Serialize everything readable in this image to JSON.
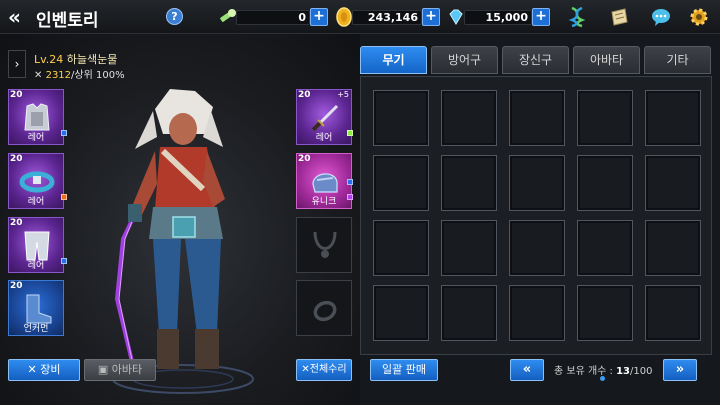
{
  "header": {
    "title": "인벤토리",
    "stamina": "0",
    "gold": "243,146",
    "gems": "15,000"
  },
  "character": {
    "level": "Lv.24",
    "name": "하늘색눈물",
    "power": "2312",
    "rank": "/상위 100%"
  },
  "left_slots": [
    {
      "level": "20",
      "grade": "레어"
    },
    {
      "level": "20",
      "grade": "레어"
    },
    {
      "level": "20",
      "grade": "레어"
    },
    {
      "level": "20",
      "grade": "언커먼"
    }
  ],
  "right_slots": [
    {
      "level": "20",
      "grade": "레어",
      "enhance": "+5"
    },
    {
      "level": "20",
      "grade": "유니크"
    }
  ],
  "buttons": {
    "equip": "장비",
    "avatar": "아바타",
    "repair_all": "전체수리",
    "bulk_sell": "일괄 판매"
  },
  "tabs": [
    {
      "label": "무기",
      "active": true
    },
    {
      "label": "방어구",
      "active": false
    },
    {
      "label": "장신구",
      "active": false
    },
    {
      "label": "아바타",
      "active": false
    },
    {
      "label": "기타",
      "active": false
    }
  ],
  "inventory": {
    "count_label": "총 보유 개수 :",
    "count": "13",
    "max": "/100"
  },
  "colors": {
    "accent_blue": "#1d6fd6",
    "rare": "#5b2590",
    "unique": "#a02a9a",
    "uncommon": "#183f8a",
    "gold_text": "#ffd04a"
  }
}
